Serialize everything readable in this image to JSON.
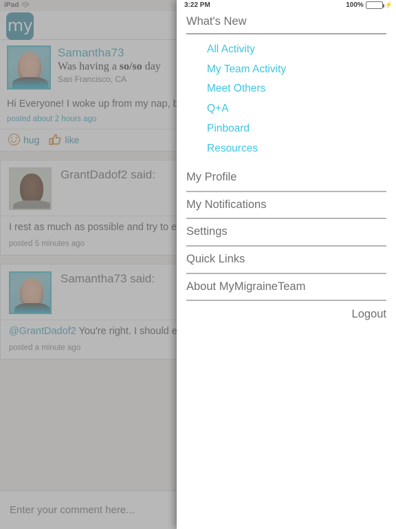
{
  "status_bar": {
    "device": "iPad",
    "wifi_icon": "wifi-icon",
    "time": "3:22 PM",
    "battery_percent": "100%",
    "battery_icon": "battery-full-icon",
    "charging_icon": "lightning-bolt-icon",
    "battery_color": "#4cd964"
  },
  "nav": {
    "logo_text": "my",
    "logo_color": "#3f8fa4"
  },
  "post": {
    "avatar_name": "samantha73-avatar",
    "username": "Samantha73",
    "mood_prefix": "Was having a ",
    "mood_value": "so/so",
    "mood_suffix": " day",
    "location": "San Francisco, CA",
    "body": "Hi Everyone! I woke up from my nap, but I still feel awful. We are having a BBQ for the family to meet the baby.  I have family flying in just to see the baby.  How do others fight through the pain?",
    "timestamp": "posted about 2 hours ago",
    "actions": [
      {
        "icon": "smiley-hug-icon",
        "label": "hug"
      },
      {
        "icon": "thumbs-up-like-icon",
        "label": "like"
      }
    ]
  },
  "comments": [
    {
      "avatar_name": "grantdadof2-avatar",
      "header": "GrantDadof2 said:",
      "mention": "",
      "body": "I rest as much as possible and try to eat well and stay hydrated. I also tell people I'm not feeling well enough to go out.",
      "timestamp": "posted 5 minutes ago"
    },
    {
      "avatar_name": "samantha73-avatar",
      "header": "Samantha73 said:",
      "mention": "@GrantDadof2",
      "body": " You're right. I should eat better and drink more water. I think in this situation I should postpone the BBQ until I feel better. So good to know others go through this too.",
      "timestamp": "posted a  minute ago"
    }
  ],
  "comment_box": {
    "placeholder": "Enter your comment here...",
    "value": ""
  },
  "menu": {
    "section_title": "What's New",
    "sub_items": [
      {
        "label": "All Activity"
      },
      {
        "label": "My Team Activity"
      },
      {
        "label": "Meet Others"
      },
      {
        "label": "Q+A"
      },
      {
        "label": "Pinboard"
      },
      {
        "label": "Resources"
      }
    ],
    "items": [
      {
        "label": "My Profile"
      },
      {
        "label": "My Notifications"
      },
      {
        "label": "Settings"
      },
      {
        "label": "Quick Links"
      },
      {
        "label": "About MyMigraineTeam"
      }
    ],
    "logout_label": "Logout",
    "link_color": "#3fc6e0",
    "text_color": "#6f6f6f"
  }
}
